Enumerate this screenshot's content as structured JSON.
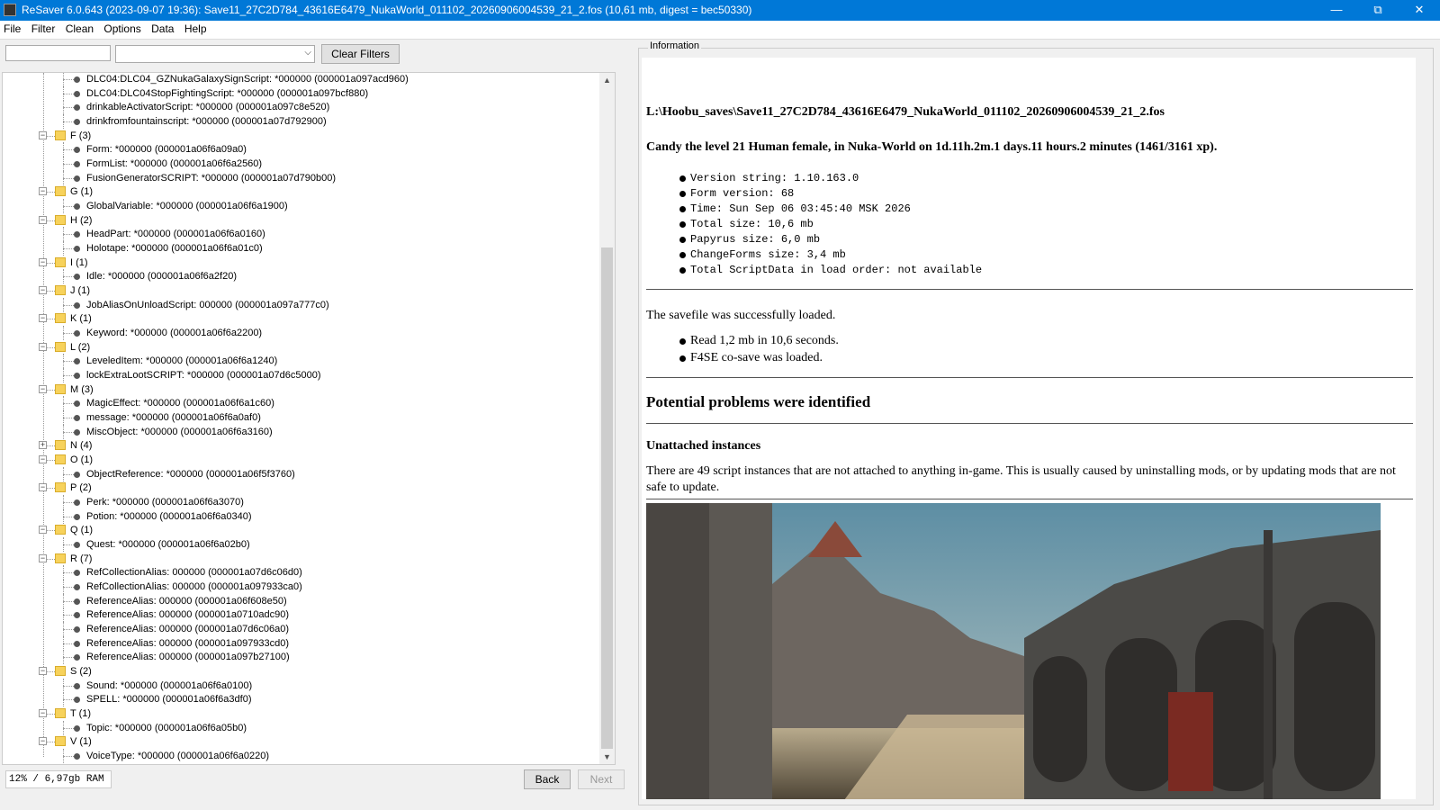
{
  "window": {
    "title": "ReSaver 6.0.643 (2023-09-07 19:36): Save11_27C2D784_43616E6479_NukaWorld_011102_20260906004539_21_2.fos (10,61 mb, digest = bec50330)",
    "minimize": "—",
    "maximize": "⧉",
    "close": "✕"
  },
  "menu": [
    "File",
    "Filter",
    "Clean",
    "Options",
    "Data",
    "Help"
  ],
  "filter": {
    "text_value": "",
    "combo_value": "",
    "clear_label": "Clear Filters"
  },
  "tree": [
    {
      "kind": "item",
      "text": "DLC04:DLC04_GZNukaGalaxySignScript: *000000 (000001a097acd960)"
    },
    {
      "kind": "item",
      "text": "DLC04:DLC04StopFightingScript: *000000 (000001a097bcf880)"
    },
    {
      "kind": "item",
      "text": "drinkableActivatorScript: *000000 (000001a097c8e520)"
    },
    {
      "kind": "item",
      "text": "drinkfromfountainscript: *000000 (000001a07d792900)"
    },
    {
      "kind": "cat",
      "text": "F (3)",
      "expanded": true
    },
    {
      "kind": "item",
      "text": "Form: *000000 (000001a06f6a09a0)"
    },
    {
      "kind": "item",
      "text": "FormList: *000000 (000001a06f6a2560)"
    },
    {
      "kind": "item",
      "text": "FusionGeneratorSCRIPT: *000000 (000001a07d790b00)"
    },
    {
      "kind": "cat",
      "text": "G (1)",
      "expanded": true
    },
    {
      "kind": "item",
      "text": "GlobalVariable: *000000 (000001a06f6a1900)"
    },
    {
      "kind": "cat",
      "text": "H (2)",
      "expanded": true
    },
    {
      "kind": "item",
      "text": "HeadPart: *000000 (000001a06f6a0160)"
    },
    {
      "kind": "item",
      "text": "Holotape: *000000 (000001a06f6a01c0)"
    },
    {
      "kind": "cat",
      "text": "I (1)",
      "expanded": true
    },
    {
      "kind": "item",
      "text": "Idle: *000000 (000001a06f6a2f20)"
    },
    {
      "kind": "cat",
      "text": "J (1)",
      "expanded": true
    },
    {
      "kind": "item",
      "text": "JobAliasOnUnloadScript: 000000 (000001a097a777c0)"
    },
    {
      "kind": "cat",
      "text": "K (1)",
      "expanded": true
    },
    {
      "kind": "item",
      "text": "Keyword: *000000 (000001a06f6a2200)"
    },
    {
      "kind": "cat",
      "text": "L (2)",
      "expanded": true
    },
    {
      "kind": "item",
      "text": "LeveledItem: *000000 (000001a06f6a1240)"
    },
    {
      "kind": "item",
      "text": "lockExtraLootSCRIPT: *000000 (000001a07d6c5000)"
    },
    {
      "kind": "cat",
      "text": "M (3)",
      "expanded": true
    },
    {
      "kind": "item",
      "text": "MagicEffect: *000000 (000001a06f6a1c60)"
    },
    {
      "kind": "item",
      "text": "message: *000000 (000001a06f6a0af0)"
    },
    {
      "kind": "item",
      "text": "MiscObject: *000000 (000001a06f6a3160)"
    },
    {
      "kind": "cat",
      "text": "N (4)",
      "expanded": false
    },
    {
      "kind": "cat",
      "text": "O (1)",
      "expanded": true
    },
    {
      "kind": "item",
      "text": "ObjectReference: *000000 (000001a06f5f3760)"
    },
    {
      "kind": "cat",
      "text": "P (2)",
      "expanded": true
    },
    {
      "kind": "item",
      "text": "Perk: *000000 (000001a06f6a3070)"
    },
    {
      "kind": "item",
      "text": "Potion: *000000 (000001a06f6a0340)"
    },
    {
      "kind": "cat",
      "text": "Q (1)",
      "expanded": true
    },
    {
      "kind": "item",
      "text": "Quest: *000000 (000001a06f6a02b0)"
    },
    {
      "kind": "cat",
      "text": "R (7)",
      "expanded": true
    },
    {
      "kind": "item",
      "text": "RefCollectionAlias: 000000 (000001a07d6c06d0)"
    },
    {
      "kind": "item",
      "text": "RefCollectionAlias: 000000 (000001a097933ca0)"
    },
    {
      "kind": "item",
      "text": "ReferenceAlias: 000000 (000001a06f608e50)"
    },
    {
      "kind": "item",
      "text": "ReferenceAlias: 000000 (000001a0710adc90)"
    },
    {
      "kind": "item",
      "text": "ReferenceAlias: 000000 (000001a07d6c06a0)"
    },
    {
      "kind": "item",
      "text": "ReferenceAlias: 000000 (000001a097933cd0)"
    },
    {
      "kind": "item",
      "text": "ReferenceAlias: 000000 (000001a097b27100)"
    },
    {
      "kind": "cat",
      "text": "S (2)",
      "expanded": true
    },
    {
      "kind": "item",
      "text": "Sound: *000000 (000001a06f6a0100)"
    },
    {
      "kind": "item",
      "text": "SPELL: *000000 (000001a06f6a3df0)"
    },
    {
      "kind": "cat",
      "text": "T (1)",
      "expanded": true
    },
    {
      "kind": "item",
      "text": "Topic: *000000 (000001a06f6a05b0)"
    },
    {
      "kind": "cat",
      "text": "V (1)",
      "expanded": true
    },
    {
      "kind": "item",
      "text": "VoiceType: *000000 (000001a06f6a0220)"
    }
  ],
  "status": {
    "memory": "12% / 6,97gb RAM"
  },
  "nav": {
    "back": "Back",
    "next": "Next"
  },
  "info": {
    "group_label": "Information",
    "path": "L:\\Hoobu_saves\\Save11_27C2D784_43616E6479_NukaWorld_011102_20260906004539_21_2.fos",
    "summary": "Candy the level 21 Human female, in Nuka-World on 1d.11h.2m.1 days.11 hours.2 minutes (1461/3161 xp).",
    "stats": [
      "Version string: 1.10.163.0",
      "Form version: 68",
      "Time: Sun Sep 06 03:45:40 MSK 2026",
      "Total size: 10,6 mb",
      "Papyrus size: 6,0 mb",
      "ChangeForms size: 3,4 mb",
      "Total ScriptData in load order: not available"
    ],
    "loaded": "The savefile was successfully loaded.",
    "load_items": [
      "Read 1,2 mb in 10,6 seconds.",
      "F4SE co-save was loaded."
    ],
    "problems_heading": "Potential problems were identified",
    "unattached_heading": "Unattached instances",
    "unattached_line1": "There are 49 script instances that are not attached to anything in-game. This is usually caused by uninstalling mods, or by updating mods that are not",
    "unattached_line2": "safe to update."
  },
  "colors": {
    "titlebar": "#0078d7",
    "folder": "#f7d25b"
  }
}
